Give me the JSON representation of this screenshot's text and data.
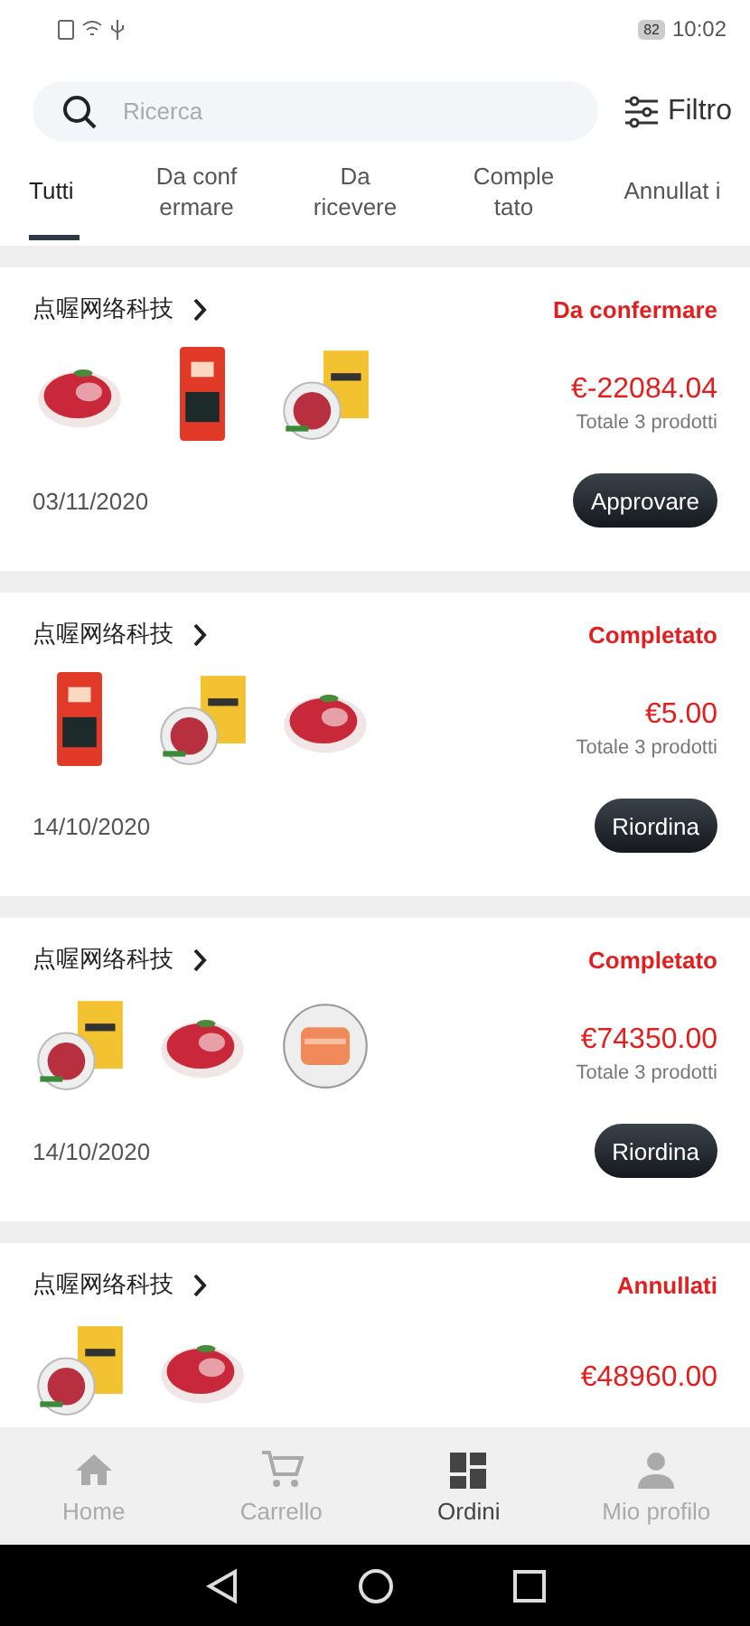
{
  "status_bar": {
    "battery": "82",
    "time": "10:02"
  },
  "search": {
    "placeholder": "Ricerca"
  },
  "filter": {
    "label": "Filtro"
  },
  "tabs": [
    {
      "label": "Tutti",
      "selected": true
    },
    {
      "label": "Da conf ermare",
      "selected": false
    },
    {
      "label": "Da ricevere",
      "selected": false
    },
    {
      "label": "Comple tato",
      "selected": false
    },
    {
      "label": "Annullat i",
      "selected": false
    }
  ],
  "orders": [
    {
      "shop": "点喔网络科技",
      "status": "Da confermare",
      "price": "€-22084.04",
      "total": "Totale 3 prodotti",
      "date": "03/11/2020",
      "action": "Approvare"
    },
    {
      "shop": "点喔网络科技",
      "status": "Completato",
      "price": "€5.00",
      "total": "Totale 3 prodotti",
      "date": "14/10/2020",
      "action": "Riordina"
    },
    {
      "shop": "点喔网络科技",
      "status": "Completato",
      "price": "€74350.00",
      "total": "Totale 3 prodotti",
      "date": "14/10/2020",
      "action": "Riordina"
    },
    {
      "shop": "点喔网络科技",
      "status": "Annullati",
      "price": "€48960.00"
    }
  ],
  "bottom_nav": [
    {
      "label": "Home",
      "selected": false
    },
    {
      "label": "Carrello",
      "selected": false
    },
    {
      "label": "Ordini",
      "selected": true
    },
    {
      "label": "Mio profilo",
      "selected": false
    }
  ]
}
